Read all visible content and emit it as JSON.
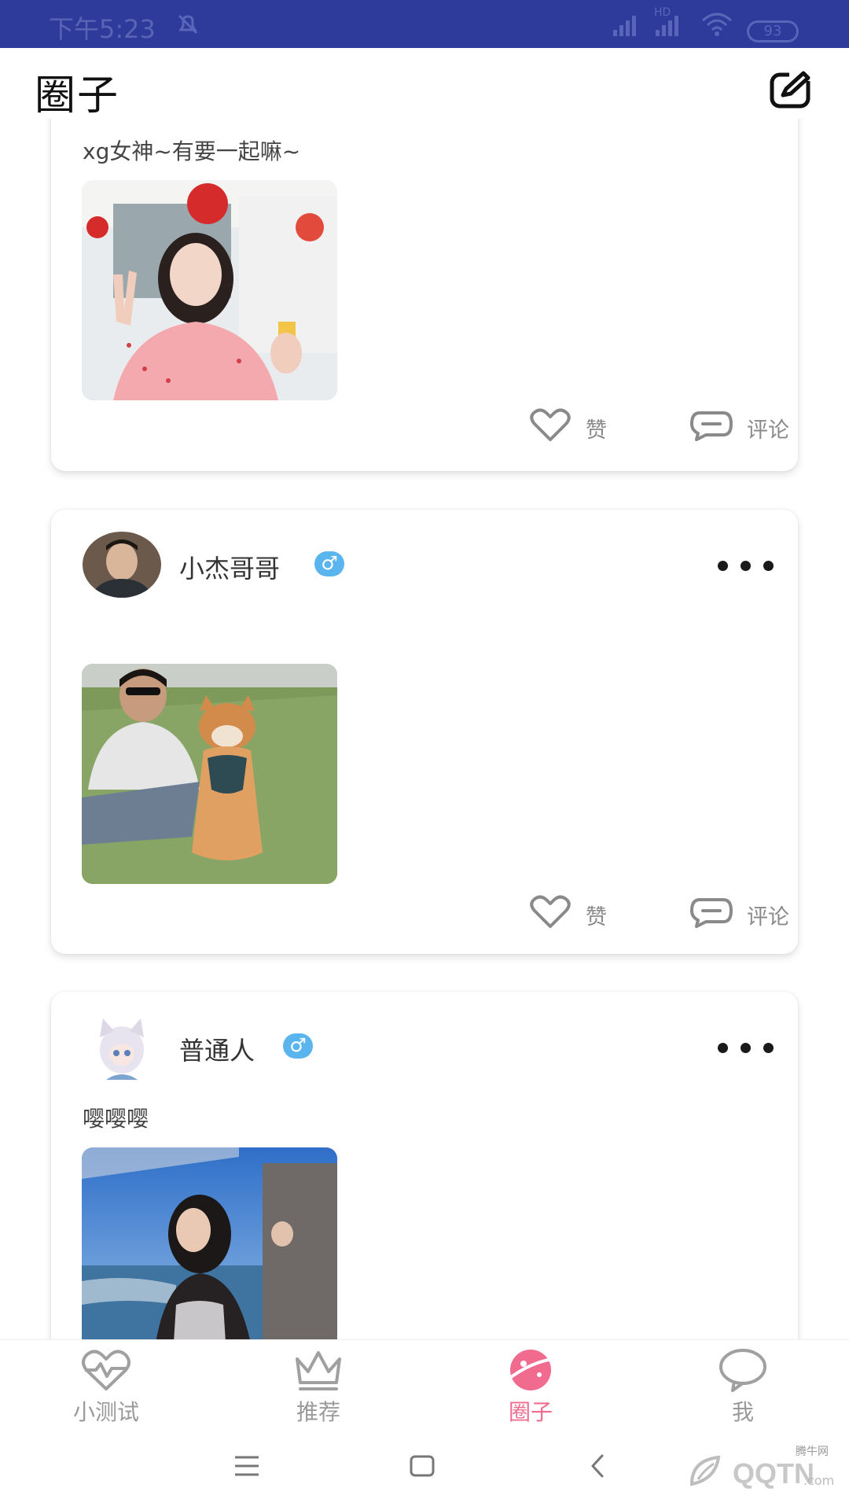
{
  "status_bar": {
    "time": "下午5:23",
    "hd": "HD",
    "battery": "93"
  },
  "header": {
    "title": "圈子"
  },
  "posts": [
    {
      "text": "xg女神~有要一起嘛~",
      "like_label": "赞",
      "comment_label": "评论"
    },
    {
      "username": "小杰哥哥",
      "gender_symbol": "♂",
      "like_label": "赞",
      "comment_label": "评论"
    },
    {
      "username": "普通人",
      "gender_symbol": "♂",
      "text": "嘤嘤嘤"
    }
  ],
  "bottom_nav": [
    {
      "label": "小测试",
      "icon": "heartbeat-icon"
    },
    {
      "label": "推荐",
      "icon": "crown-icon"
    },
    {
      "label": "圈子",
      "icon": "planet-icon",
      "active": true
    },
    {
      "label": "我",
      "icon": "chat-bubble-icon"
    }
  ],
  "watermark": {
    "top": "腾牛网",
    "main": "QQTN",
    "suffix": ".com"
  },
  "colors": {
    "status_bar": "#2f3b9b",
    "accent": "#f06c8e",
    "gender": "#5ab5ef"
  }
}
